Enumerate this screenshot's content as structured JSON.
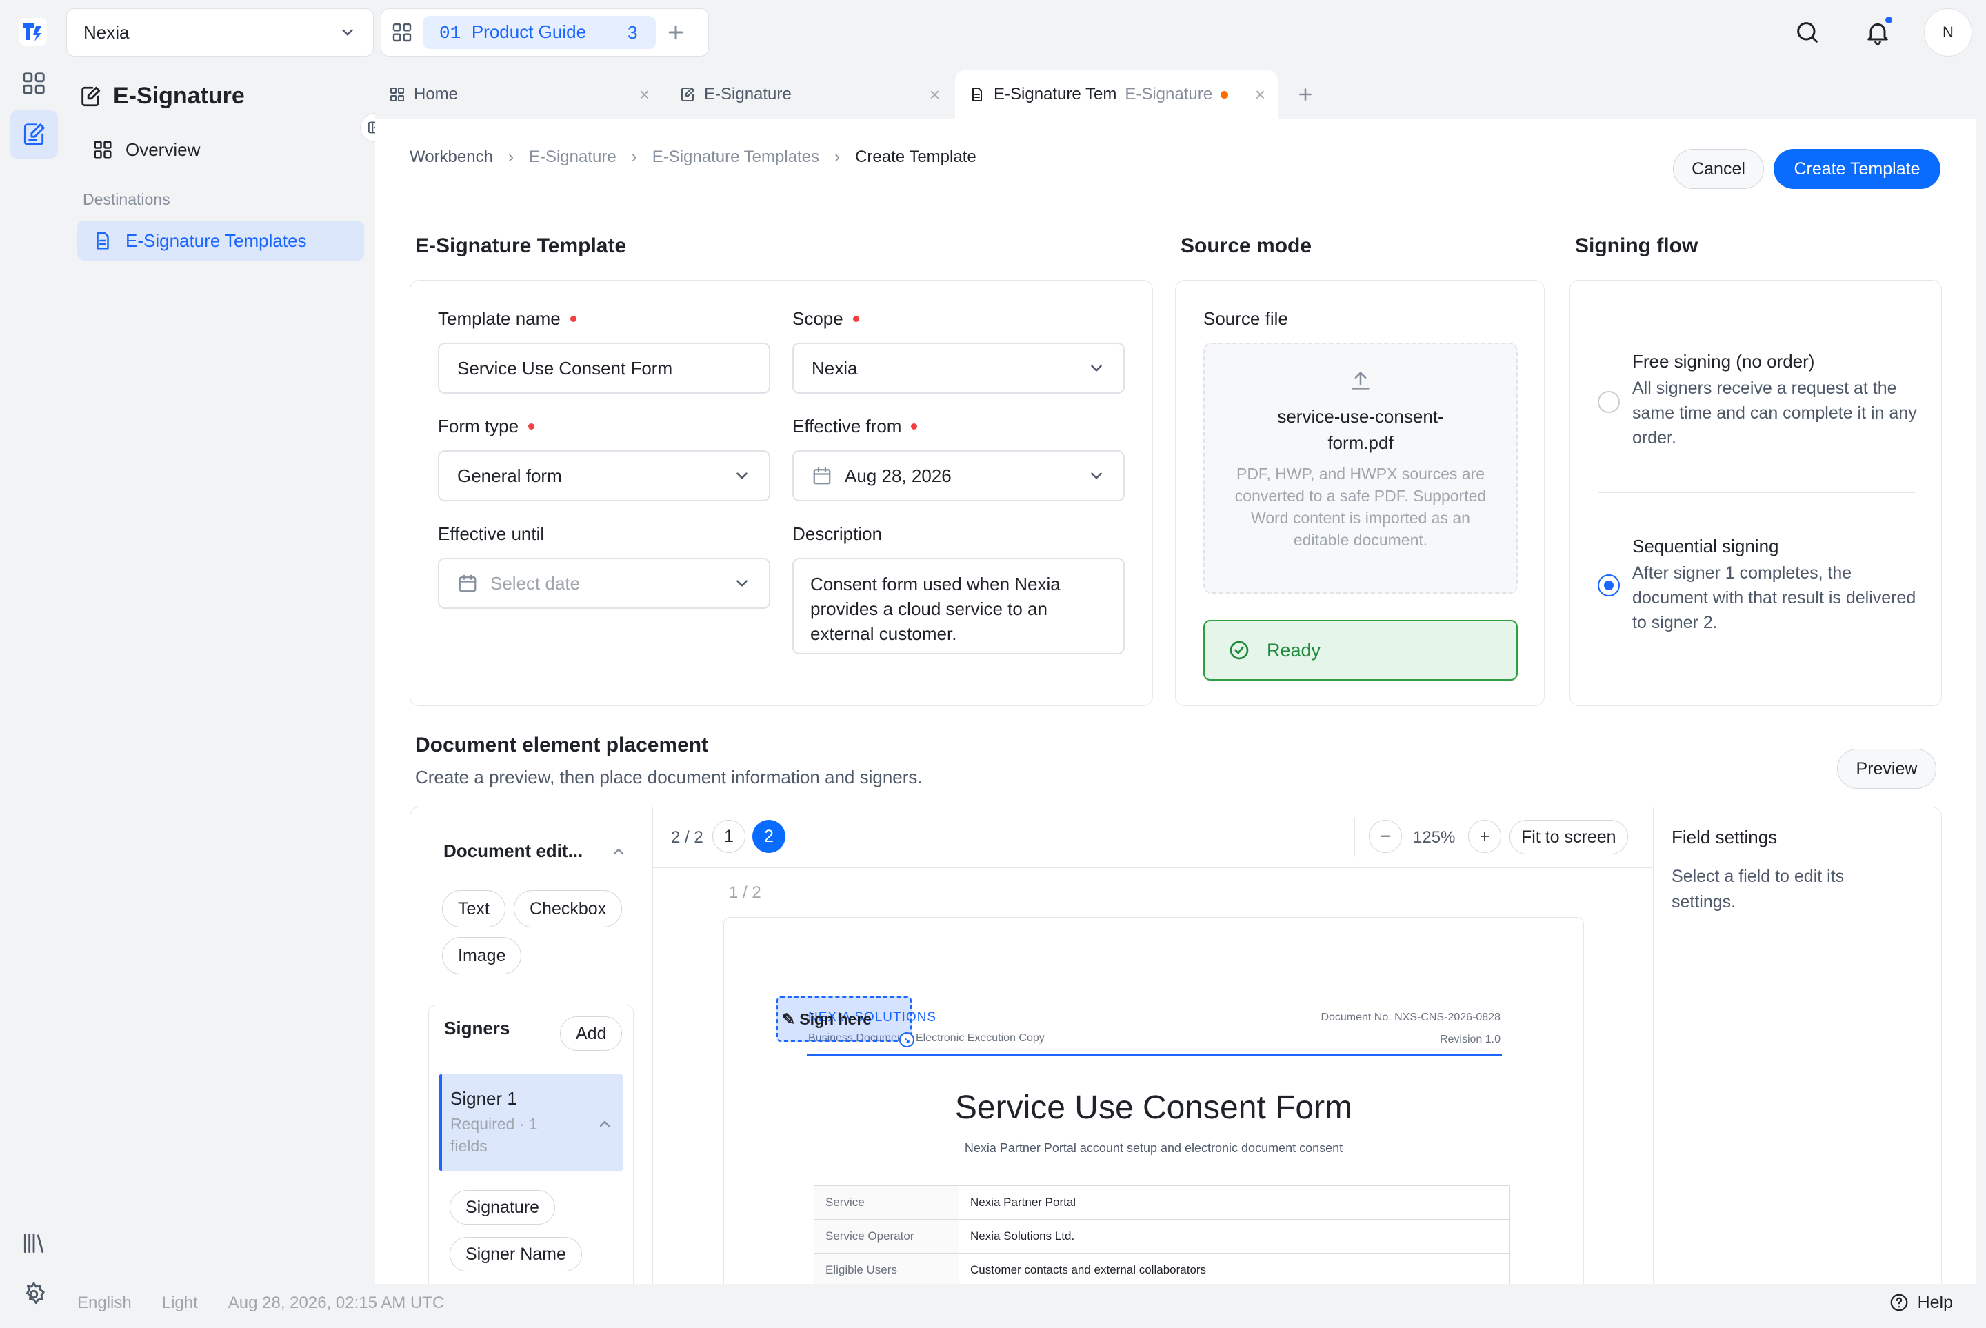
{
  "rail": {
    "items": [
      "apps-icon",
      "esign-icon",
      "library-icon",
      "settings-icon"
    ]
  },
  "workspace": {
    "name": "Nexia"
  },
  "top_tab": {
    "index": "01",
    "label": "Product Guide",
    "count": "3"
  },
  "user": {
    "initial": "N"
  },
  "sidebar": {
    "title": "E-Signature",
    "overview": "Overview",
    "group_label": "Destinations",
    "templates": "E-Signature Templates"
  },
  "tabs": {
    "home": "Home",
    "esign": "E-Signature",
    "active_title": "E-Signature Tem",
    "active_sub": "E-Signature"
  },
  "breadcrumb": [
    "Workbench",
    "E-Signature",
    "E-Signature Templates",
    "Create Template"
  ],
  "actions": {
    "cancel": "Cancel",
    "create": "Create Template"
  },
  "template": {
    "heading": "E-Signature Template",
    "name_label": "Template name",
    "name_value": "Service Use Consent Form",
    "scope_label": "Scope",
    "scope_value": "Nexia",
    "form_type_label": "Form type",
    "form_type_value": "General form",
    "effective_from_label": "Effective from",
    "effective_from_value": "Aug 28, 2026",
    "effective_until_label": "Effective until",
    "effective_until_placeholder": "Select date",
    "description_label": "Description",
    "description_value": "Consent form used when Nexia provides a cloud service to an external customer."
  },
  "source": {
    "heading": "Source mode",
    "file_label": "Source file",
    "file_name_1": "service-use-consent-",
    "file_name_2": "form.pdf",
    "hint": "PDF, HWP, and HWPX sources are converted to a safe PDF. Supported Word content is imported as an editable document.",
    "status": "Ready"
  },
  "flow": {
    "heading": "Signing flow",
    "free_title": "Free signing (no order)",
    "free_desc": "All signers receive a request at the same time and can complete it in any order.",
    "seq_title": "Sequential signing",
    "seq_desc": "After signer 1 completes, the document with that result is delivered to signer 2.",
    "selected": "sequential"
  },
  "placement": {
    "heading": "Document element placement",
    "subtitle": "Create a preview, then place document information and signers.",
    "preview": "Preview",
    "doc_section": "Document edit...",
    "elements": [
      "Text",
      "Checkbox",
      "Image"
    ],
    "signers_label": "Signers",
    "add": "Add",
    "signer_name": "Signer 1",
    "signer_meta_1": "Required · 1",
    "signer_meta_2": "fields",
    "signer_fields": [
      "Signature",
      "Signer Name"
    ],
    "page_indicator": "2 / 2",
    "pages": [
      "1",
      "2"
    ],
    "current_page": "2",
    "zoom": "125%",
    "fit": "Fit to screen",
    "page_label": "1 / 2",
    "settings_title": "Field settings",
    "settings_hint": "Select a field to edit its settings."
  },
  "document": {
    "brand": "NEXIA SOLUTIONS",
    "brand_sub": "Business Document",
    "copy": "Electronic Execution Copy",
    "doc_no": "Document No. NXS-CNS-2026-0828",
    "revision": "Revision 1.0",
    "sign_here": "Sign here",
    "title": "Service Use Consent Form",
    "subtitle": "Nexia Partner Portal account setup and electronic document consent",
    "rows": [
      {
        "k": "Service",
        "v": "Nexia Partner Portal"
      },
      {
        "k": "Service Operator",
        "v": "Nexia Solutions Ltd."
      },
      {
        "k": "Eligible Users",
        "v": "Customer contacts and external collaborators"
      }
    ]
  },
  "footer": {
    "language": "English",
    "theme": "Light",
    "time": "Aug 28, 2026, 02:15 AM UTC",
    "help": "Help"
  },
  "colors": {
    "accent": "#0a6cff",
    "active_bg": "#dce7fb",
    "ready_bg": "#e6f5ea",
    "ready_border": "#2ea043",
    "required": "#f53f3f"
  }
}
